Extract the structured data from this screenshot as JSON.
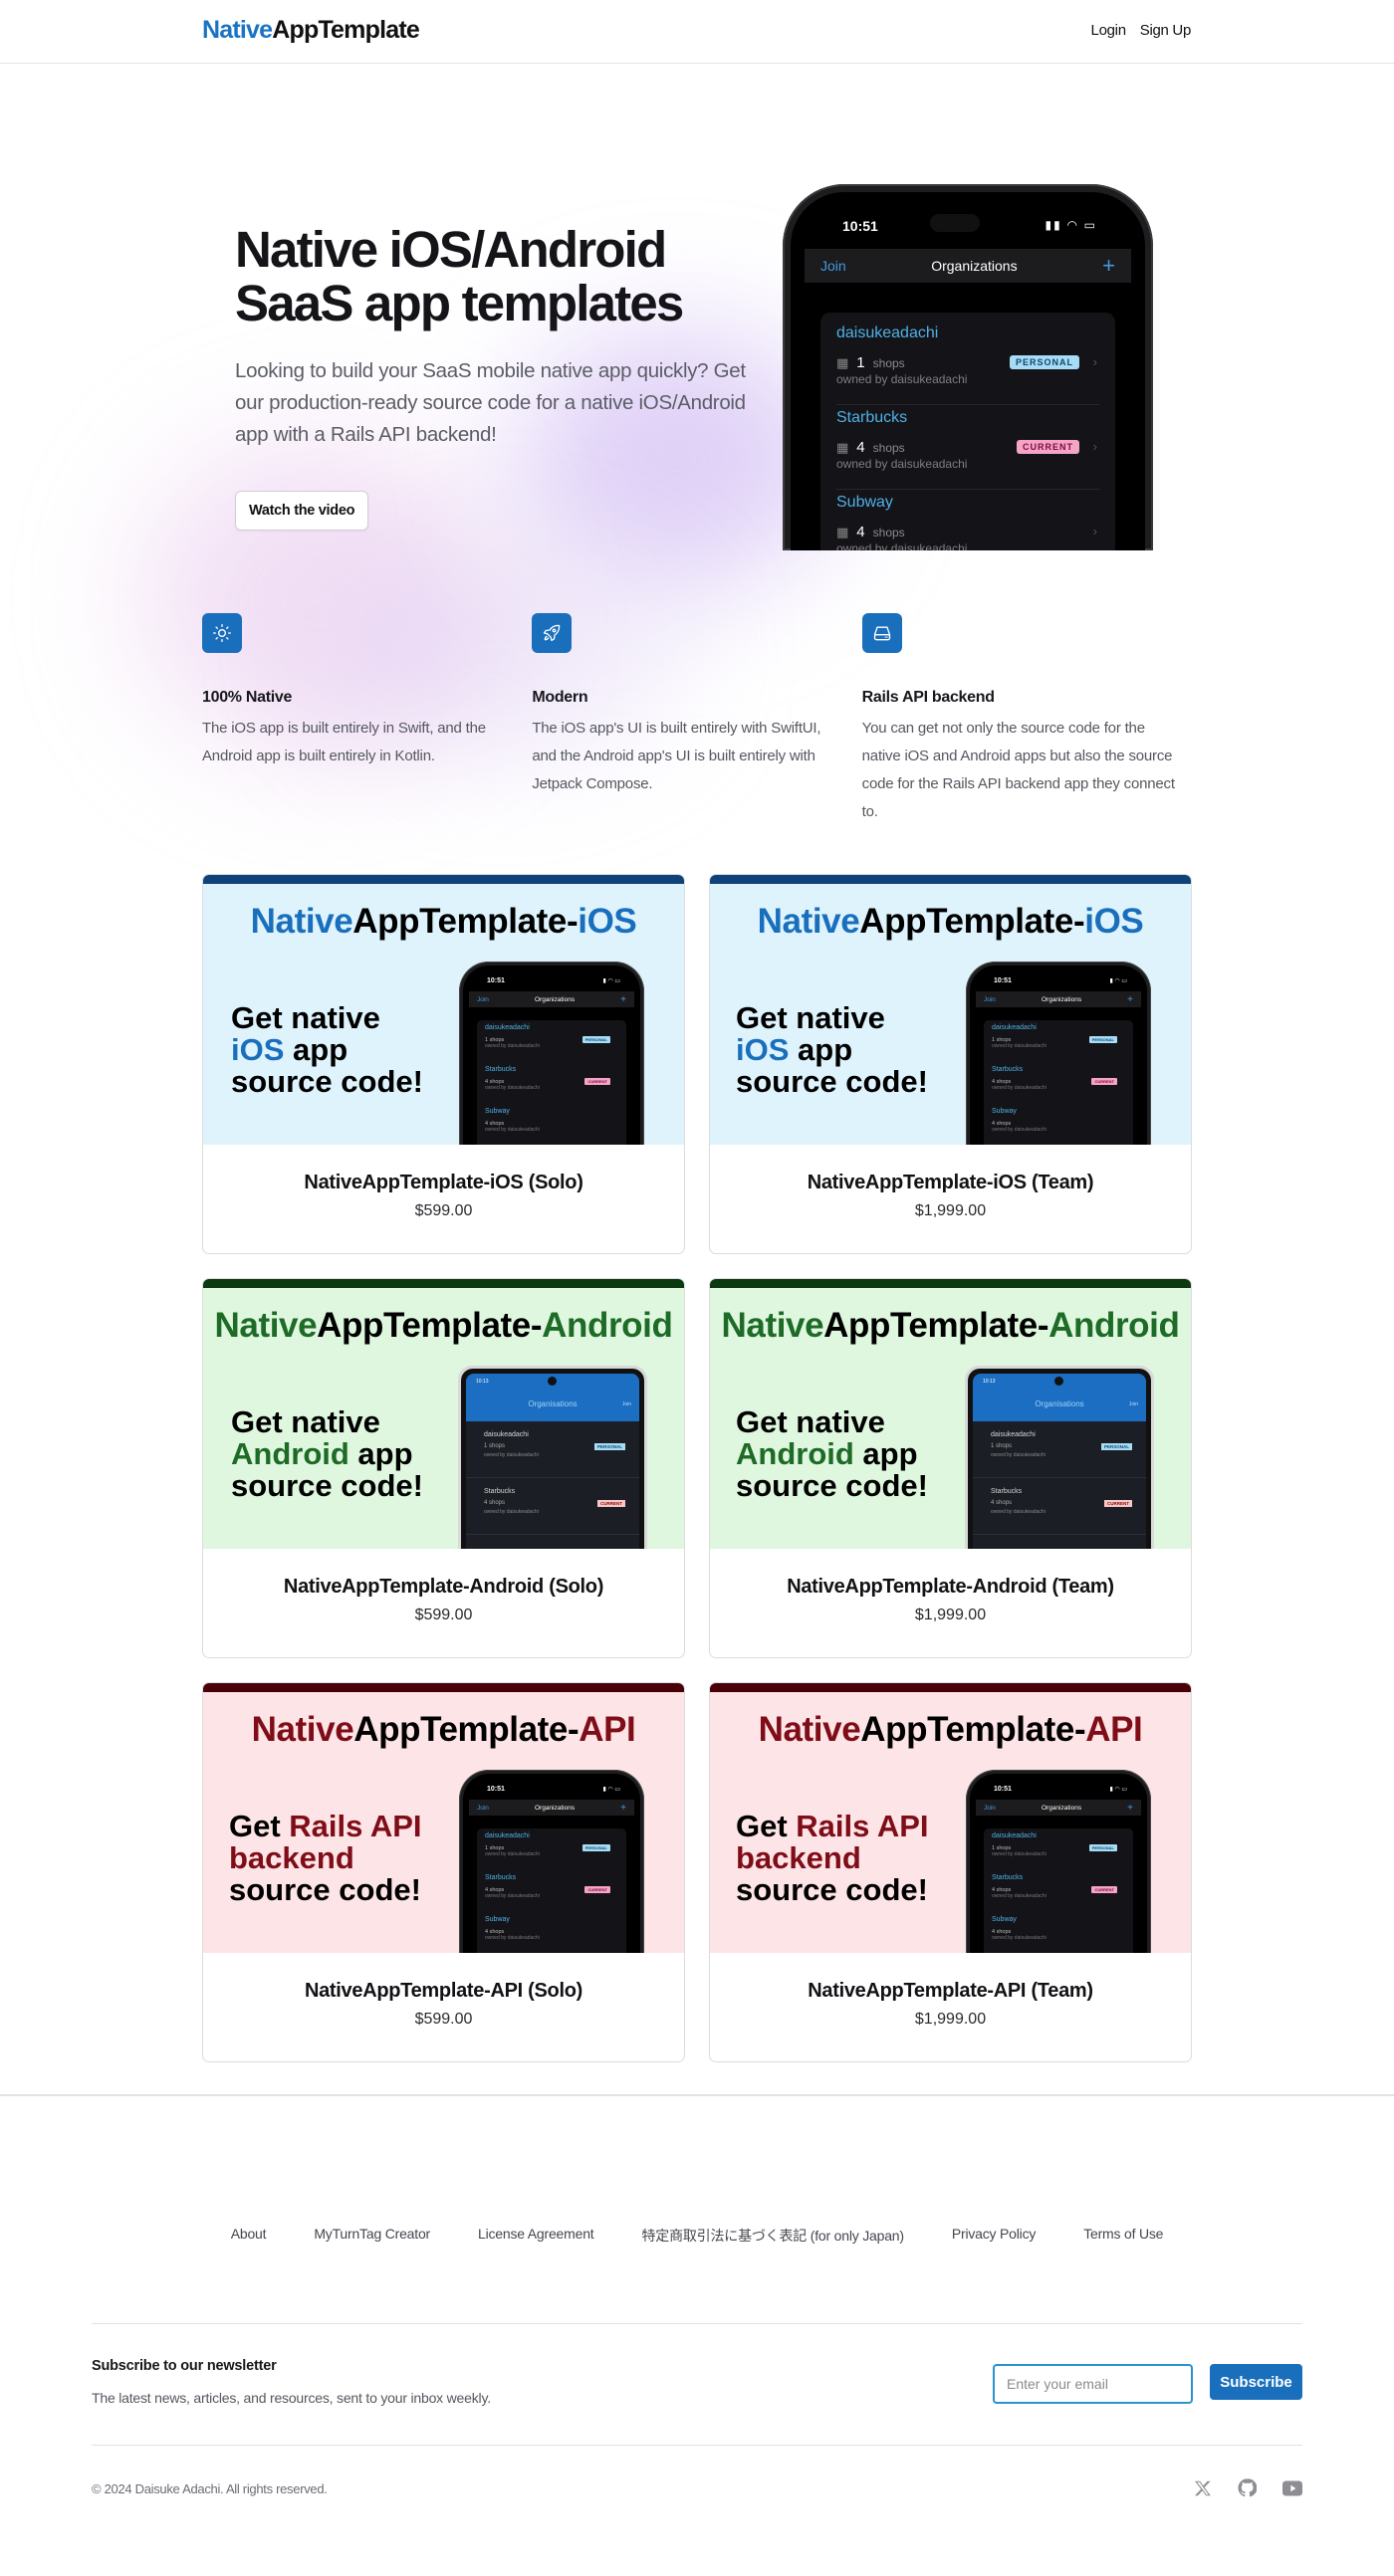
{
  "header": {
    "logo_part1": "Native",
    "logo_part2": "AppTemplate",
    "login_label": "Login",
    "signup_label": "Sign Up"
  },
  "hero": {
    "title_line1": "Native iOS/Android",
    "title_line2": "SaaS app templates",
    "subtitle": "Looking to build your SaaS mobile native app quickly? Get our production-ready source code for a native iOS/Android app with a Rails API backend!",
    "watch_video_label": "Watch the video",
    "phone": {
      "time": "10:51",
      "nav_left": "Join",
      "nav_title": "Organizations",
      "nav_right": "+",
      "orgs": [
        {
          "name": "daisukeadachi",
          "count": "1",
          "unit": "shops",
          "owner": "owned by daisukeadachi",
          "badge": "PERSONAL"
        },
        {
          "name": "Starbucks",
          "count": "4",
          "unit": "shops",
          "owner": "owned by daisukeadachi",
          "badge": "CURRENT"
        },
        {
          "name": "Subway",
          "count": "4",
          "unit": "shops",
          "owner": "owned by daisukeadachi",
          "badge": ""
        }
      ]
    }
  },
  "features": [
    {
      "icon": "sun-icon",
      "title": "100% Native",
      "desc": "The iOS app is built entirely in Swift, and the Android app is built entirely in Kotlin."
    },
    {
      "icon": "rocket-icon",
      "title": "Modern",
      "desc": "The iOS app's UI is built entirely with SwiftUI, and the Android app's UI is built entirely with Jetpack Compose."
    },
    {
      "icon": "server-icon",
      "title": "Rails API backend",
      "desc": "You can get not only the source code for the native iOS and Android apps but also the source code for the Rails API backend app they connect to."
    }
  ],
  "products": [
    {
      "banner_native": "Native",
      "banner_mid": "AppTemplate-",
      "banner_suffix": "iOS",
      "tag_l1a": "Get native",
      "tag_l1b": "",
      "tag_l2a": "iOS",
      "tag_l2b": " app",
      "tag_l3": "source code!",
      "name": "NativeAppTemplate-iOS (Solo)",
      "price": "$599.00"
    },
    {
      "banner_native": "Native",
      "banner_mid": "AppTemplate-",
      "banner_suffix": "iOS",
      "tag_l1a": "Get native",
      "tag_l1b": "",
      "tag_l2a": "iOS",
      "tag_l2b": " app",
      "tag_l3": "source code!",
      "name": "NativeAppTemplate-iOS (Team)",
      "price": "$1,999.00"
    },
    {
      "banner_native": "Native",
      "banner_mid": "AppTemplate-",
      "banner_suffix": "Android",
      "tag_l1a": "Get native",
      "tag_l1b": "",
      "tag_l2a": "Android",
      "tag_l2b": " app",
      "tag_l3": "source code!",
      "name": "NativeAppTemplate-Android (Solo)",
      "price": "$599.00"
    },
    {
      "banner_native": "Native",
      "banner_mid": "AppTemplate-",
      "banner_suffix": "Android",
      "tag_l1a": "Get native",
      "tag_l1b": "",
      "tag_l2a": "Android",
      "tag_l2b": " app",
      "tag_l3": "source code!",
      "name": "NativeAppTemplate-Android (Team)",
      "price": "$1,999.00"
    },
    {
      "banner_native": "Native",
      "banner_mid": "AppTemplate-",
      "banner_suffix": "API",
      "tag_l1a": "Get ",
      "tag_l1b": "Rails API",
      "tag_l2a": "backend",
      "tag_l2b": "",
      "tag_l3": "source code!",
      "name": "NativeAppTemplate-API (Solo)",
      "price": "$599.00"
    },
    {
      "banner_native": "Native",
      "banner_mid": "AppTemplate-",
      "banner_suffix": "API",
      "tag_l1a": "Get ",
      "tag_l1b": "Rails API",
      "tag_l2a": "backend",
      "tag_l2b": "",
      "tag_l3": "source code!",
      "name": "NativeAppTemplate-API (Team)",
      "price": "$1,999.00"
    }
  ],
  "android_phone": {
    "status": "10:13",
    "title": "Organisations",
    "join": "Join",
    "orgs": [
      {
        "name": "daisukeadachi",
        "shops": "1  shops",
        "owner": "owned by daisukeadachi",
        "badge": "PERSONAL"
      },
      {
        "name": "Starbucks",
        "shops": "4  shops",
        "owner": "owned by daisukeadachi",
        "badge": "CURRENT"
      }
    ]
  },
  "footer": {
    "links": [
      "About",
      "MyTurnTag Creator",
      "License Agreement",
      "特定商取引法に基づく表記 (for only Japan)",
      "Privacy Policy",
      "Terms of Use"
    ],
    "newsletter_title": "Subscribe to our newsletter",
    "newsletter_desc": "The latest news, articles, and resources, sent to your inbox weekly.",
    "email_placeholder": "Enter your email",
    "subscribe_label": "Subscribe",
    "copyright": "© 2024 Daisuke Adachi. All rights reserved.",
    "socials": [
      "x-icon",
      "github-icon",
      "youtube-icon"
    ]
  },
  "colors": {
    "brand_blue": "#1a6fbd",
    "ios_bg": "#def3fc",
    "android_bg": "#def7de",
    "android_accent": "#1e6a27",
    "api_bg": "#fde4e6",
    "api_accent": "#7e0d18"
  }
}
